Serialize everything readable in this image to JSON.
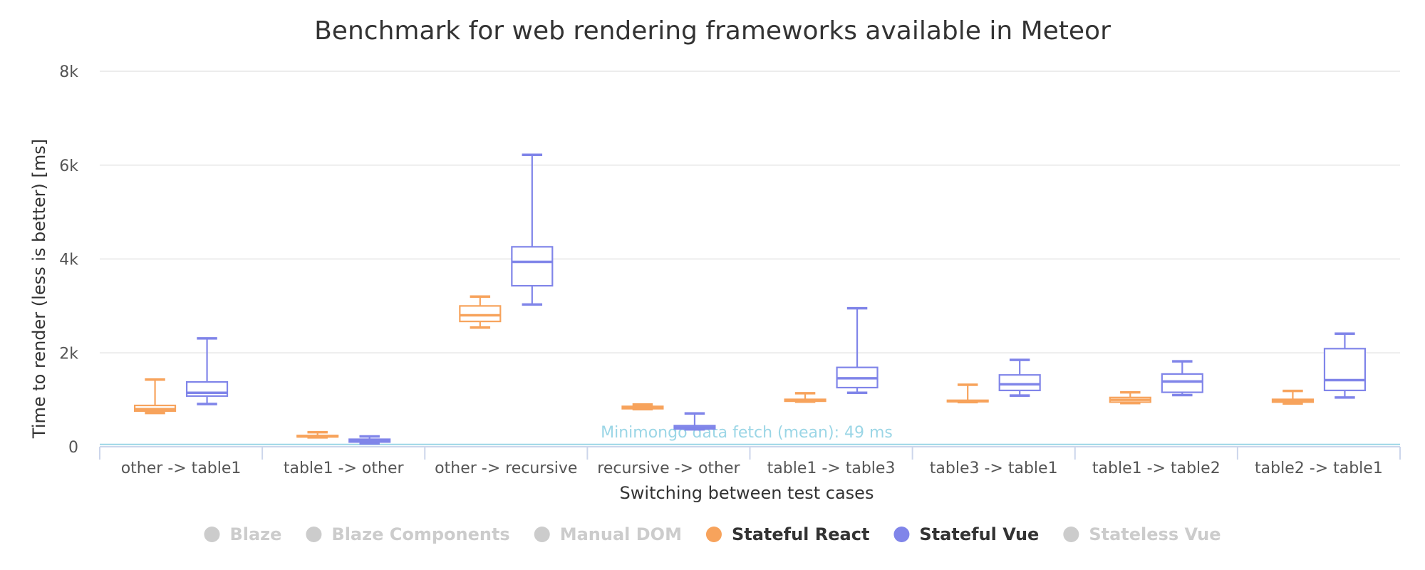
{
  "chart_data": {
    "type": "boxplot",
    "title": "Benchmark for web rendering frameworks available in Meteor",
    "xlabel": "Switching between test cases",
    "ylabel": "Time to render (less is better) [ms]",
    "ylim": [
      0,
      8000
    ],
    "y_ticks": [
      0,
      2000,
      4000,
      6000,
      8000
    ],
    "y_tick_labels": [
      "0",
      "2k",
      "4k",
      "6k",
      "8k"
    ],
    "grid": true,
    "legend_position": "bottom-center",
    "categories": [
      "other -> table1",
      "table1 -> other",
      "other -> recursive",
      "recursive -> other",
      "table1 -> table3",
      "table3 -> table1",
      "table1 -> table2",
      "table2 -> table1"
    ],
    "series": [
      {
        "name": "Stateful React",
        "color": "#f7a35c",
        "boxes": [
          {
            "low": 720,
            "q1": 760,
            "median": 800,
            "q3": 880,
            "high": 1430
          },
          {
            "low": 200,
            "q1": 210,
            "median": 220,
            "q3": 240,
            "high": 310
          },
          {
            "low": 2540,
            "q1": 2670,
            "median": 2800,
            "q3": 3000,
            "high": 3200
          },
          {
            "low": 800,
            "q1": 810,
            "median": 830,
            "q3": 860,
            "high": 900
          },
          {
            "low": 960,
            "q1": 970,
            "median": 990,
            "q3": 1010,
            "high": 1140
          },
          {
            "low": 950,
            "q1": 960,
            "median": 970,
            "q3": 990,
            "high": 1320
          },
          {
            "low": 930,
            "q1": 950,
            "median": 1000,
            "q3": 1050,
            "high": 1160
          },
          {
            "low": 920,
            "q1": 950,
            "median": 970,
            "q3": 1010,
            "high": 1190
          }
        ]
      },
      {
        "name": "Stateful Vue",
        "color": "#8085e9",
        "boxes": [
          {
            "low": 910,
            "q1": 1080,
            "median": 1150,
            "q3": 1380,
            "high": 2310
          },
          {
            "low": 70,
            "q1": 100,
            "median": 130,
            "q3": 160,
            "high": 220
          },
          {
            "low": 3030,
            "q1": 3430,
            "median": 3940,
            "q3": 4260,
            "high": 6220
          },
          {
            "low": 370,
            "q1": 380,
            "median": 410,
            "q3": 450,
            "high": 710
          },
          {
            "low": 1150,
            "q1": 1260,
            "median": 1460,
            "q3": 1690,
            "high": 2950
          },
          {
            "low": 1090,
            "q1": 1200,
            "median": 1330,
            "q3": 1530,
            "high": 1850
          },
          {
            "low": 1100,
            "q1": 1160,
            "median": 1390,
            "q3": 1550,
            "high": 1820
          },
          {
            "low": 1050,
            "q1": 1200,
            "median": 1420,
            "q3": 2090,
            "high": 2410
          }
        ]
      }
    ],
    "plot_line": {
      "value": 49,
      "label": "Minimongo data fetch (mean): 49 ms",
      "color": "#9bd6e6"
    },
    "legend": [
      {
        "name": "Blaze",
        "color": "#cccccc",
        "active": false
      },
      {
        "name": "Blaze Components",
        "color": "#cccccc",
        "active": false
      },
      {
        "name": "Manual DOM",
        "color": "#cccccc",
        "active": false
      },
      {
        "name": "Stateful React",
        "color": "#f7a35c",
        "active": true
      },
      {
        "name": "Stateful Vue",
        "color": "#8085e9",
        "active": true
      },
      {
        "name": "Stateless Vue",
        "color": "#cccccc",
        "active": false
      }
    ]
  }
}
